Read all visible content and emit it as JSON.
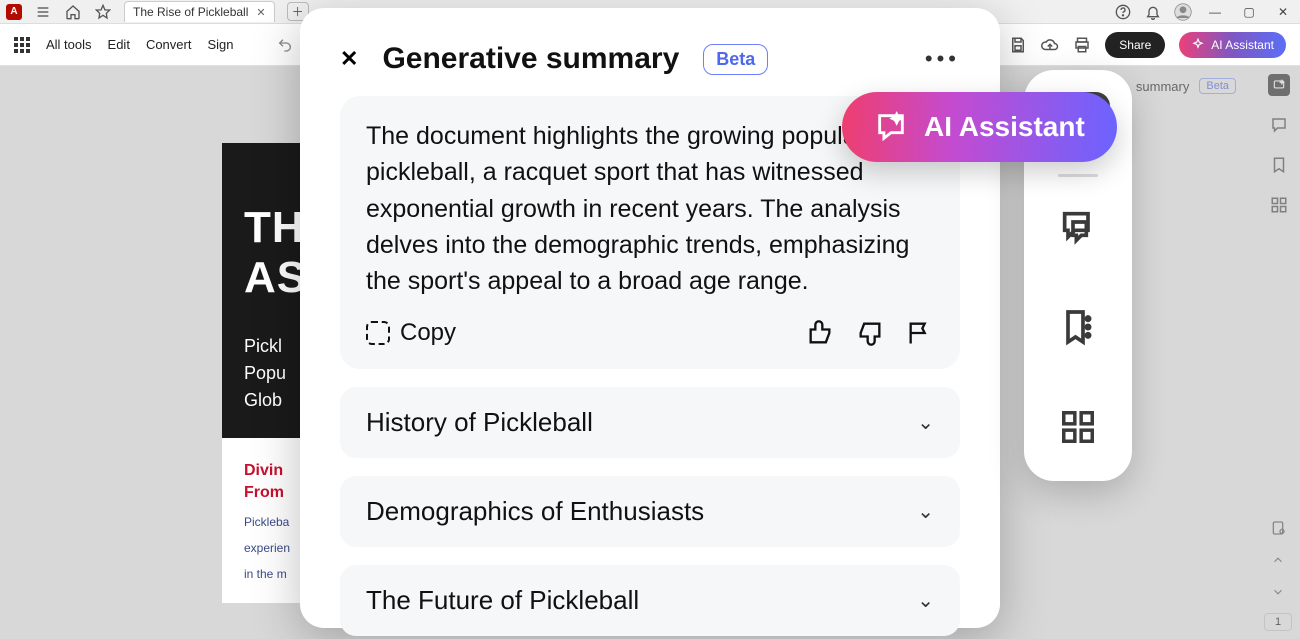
{
  "titlebar": {
    "tab_title": "The Rise of Pickleball"
  },
  "toolbar": {
    "all_tools": "All tools",
    "edit": "Edit",
    "convert": "Convert",
    "sign": "Sign",
    "share": "Share",
    "ai_assistant": "AI Assistant"
  },
  "summary_strip": {
    "label": "summary",
    "beta": "Beta"
  },
  "panel": {
    "title": "Generative summary",
    "beta": "Beta",
    "summary_text": "The document highlights the growing popularity of pickleball, a racquet sport that has witnessed exponential growth in recent years. The analysis delves into the demographic trends, emphasizing the sport's appeal to a broad age range.",
    "copy": "Copy",
    "sections": [
      {
        "title": "History of Pickleball"
      },
      {
        "title": "Demographics of Enthusiasts"
      },
      {
        "title": "The Future of Pickleball"
      }
    ]
  },
  "ai_pill": {
    "label": "AI Assistant"
  },
  "document": {
    "hero_line1": "TH",
    "hero_line2": "AS",
    "hero_sub1": "Pickl",
    "hero_sub2": "Popu",
    "hero_sub3": "Glob",
    "red_line1": "Divin",
    "red_line2": "From",
    "body1": "Pickleba",
    "body2": "experien",
    "body3": "in the m"
  },
  "page_number": "1"
}
